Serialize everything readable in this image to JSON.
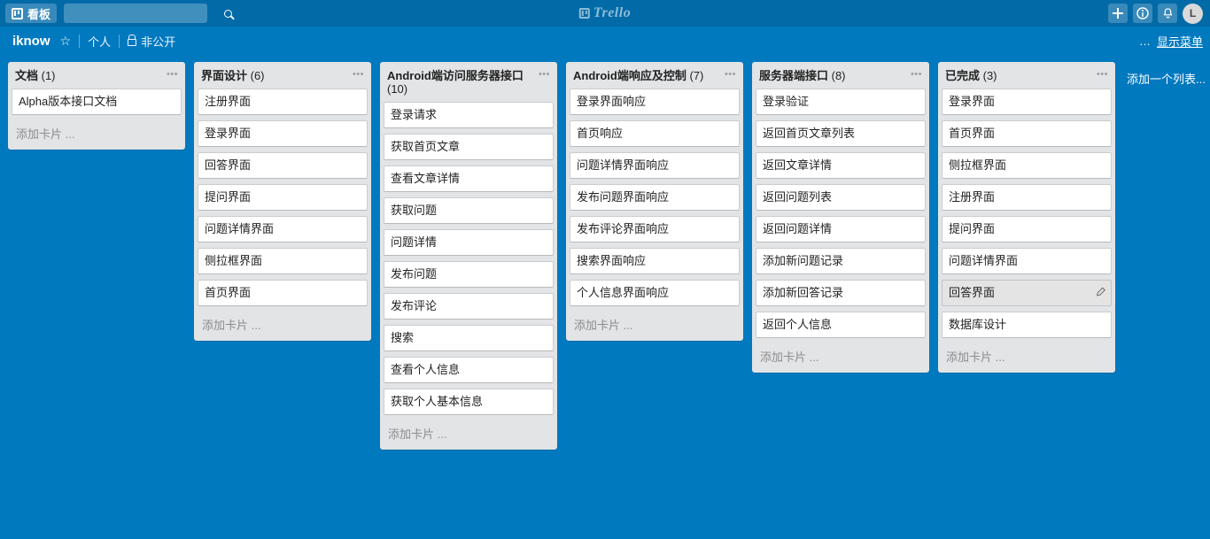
{
  "topbar": {
    "boards_button": "看板",
    "boards_icon": "board-icon",
    "search_value": "",
    "search_placeholder": "",
    "search_icon": "search-icon",
    "logo_text": "Trello",
    "logo_icon": "trello-board-icon",
    "add_icon": "plus-icon",
    "info_icon": "info-icon",
    "notifications_icon": "bell-icon",
    "avatar_initial": "L"
  },
  "boardbar": {
    "board_name": "iknow",
    "star_icon": "star-icon",
    "team": "个人",
    "lock_icon": "lock-icon",
    "visibility": "非公开",
    "menu_dots": "…",
    "show_menu": "显示菜单"
  },
  "board": {
    "add_list": "添加一个列表...",
    "add_card_label": "添加卡片 ...",
    "list_menu_icon": "list-menu-icon",
    "edit_icon": "pencil-icon",
    "lists": [
      {
        "title": "文档",
        "count": "(1)",
        "cards": [
          "Alpha版本接口文档"
        ]
      },
      {
        "title": "界面设计",
        "count": "(6)",
        "cards": [
          "注册界面",
          "登录界面",
          "回答界面",
          "提问界面",
          "问题详情界面",
          "侧拉框界面",
          "首页界面"
        ]
      },
      {
        "title": "Android端访问服务器接口",
        "count": "(10)",
        "cards": [
          "登录请求",
          "获取首页文章",
          "查看文章详情",
          "获取问题",
          "问题详情",
          "发布问题",
          "发布评论",
          "搜索",
          "查看个人信息",
          "获取个人基本信息"
        ]
      },
      {
        "title": "Android端响应及控制",
        "count": "(7)",
        "cards": [
          "登录界面响应",
          "首页响应",
          "问题详情界面响应",
          "发布问题界面响应",
          "发布评论界面响应",
          "搜索界面响应",
          "个人信息界面响应"
        ]
      },
      {
        "title": "服务器端接口",
        "count": "(8)",
        "cards": [
          "登录验证",
          "返回首页文章列表",
          "返回文章详情",
          "返回问题列表",
          "返回问题详情",
          "添加新问题记录",
          "添加新回答记录",
          "返回个人信息"
        ]
      },
      {
        "title": "已完成",
        "count": "(3)",
        "cards": [
          "登录界面",
          "首页界面",
          "侧拉框界面",
          "注册界面",
          "提问界面",
          "问题详情界面",
          "回答界面",
          "数据库设计"
        ],
        "hovered_card_index": 6
      }
    ]
  },
  "colors": {
    "board_bg": "#0079bf",
    "topbar_bg": "#026aa7",
    "list_bg": "#e2e4e6",
    "card_bg": "#ffffff"
  }
}
